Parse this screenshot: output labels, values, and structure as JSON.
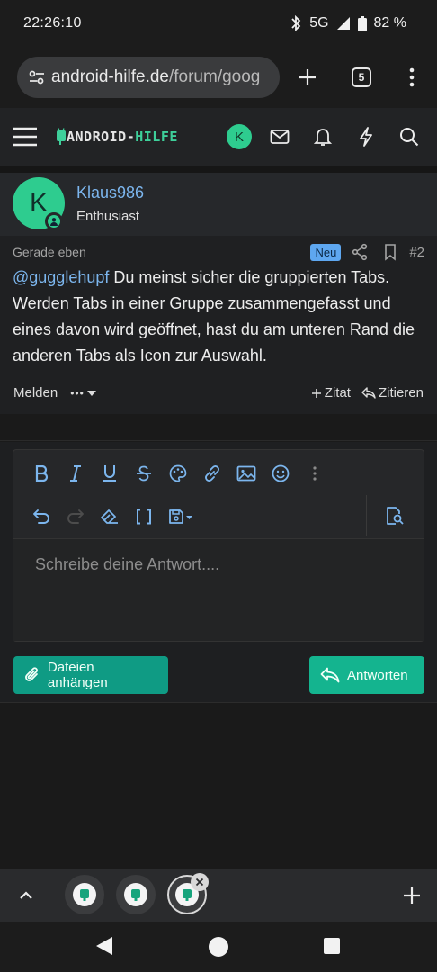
{
  "status": {
    "time": "22:26:10",
    "network": "5G",
    "battery": "82 %"
  },
  "browser": {
    "url_domain": "android-hilfe.de",
    "url_path": "/forum/goog",
    "tab_count": "5"
  },
  "site": {
    "logo_part1": "ANDROID-",
    "logo_part2": "HILFE",
    "avatar_letter": "K"
  },
  "post": {
    "author_initial": "K",
    "author": "Klaus986",
    "author_title": "Enthusiast",
    "time": "Gerade eben",
    "badge": "Neu",
    "number": "#2",
    "mention": "@gugglehupf",
    "body": " Du meinst sicher die gruppierten Tabs. Werden Tabs in einer Gruppe zusammengefasst und eines davon wird geöffnet, hast du am unteren Rand die anderen Tabs als Icon zur Auswahl.",
    "report": "Melden",
    "more": "•••",
    "quote": "Zitat",
    "reply_quote": "Zitieren"
  },
  "editor": {
    "placeholder": "Schreibe deine Antwort....",
    "attach_label": "Dateien anhängen",
    "submit_label": "Antworten"
  },
  "colors": {
    "accent": "#2ecc8f",
    "link": "#7cb6ee",
    "button": "#0f9b84"
  }
}
